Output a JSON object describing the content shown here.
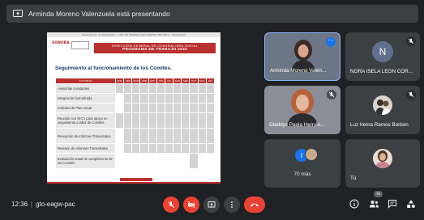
{
  "banner": {
    "text": "Arminda Moreno Valenzuela está presentando"
  },
  "slide": {
    "window_title": "Presentación de PowerPoint - GUÍA DE TRABAJO 2022 DIGITAL SECTOR A - PowerPoint",
    "logo_text": "SONORA",
    "ribbon_line1": "DIRECCIÓN GENERAL DE CONTRALORÍA SOCIAL",
    "ribbon_line2": "PROGRAMA DE TRABAJO 2022",
    "section_title": "Seguimiento al funcionamiento de los Comités.",
    "table": {
      "header": [
        "ACTIVIDAD",
        "ENE",
        "FEB",
        "MAR",
        "ABR",
        "MAY",
        "JUN",
        "JUL",
        "AGO",
        "SEP",
        "OCT",
        "NOV",
        "DIC"
      ],
      "rows": [
        "Asesorías constantes",
        "Integración formalizada",
        "Solicitud de Plan Anual",
        "Reunión con OIC's para apoyo en seguimiento a labor de Comités",
        "Recepción de Informes Trimestrales",
        "Revisión de Informes Trimestrales",
        "Evaluación anual de cumplimiento de los Comités"
      ]
    }
  },
  "participants": [
    {
      "name": "Arminda Moreno Valen...",
      "active_speaker": true
    },
    {
      "name": "NORA ISELA LEON COR...",
      "avatar_letter": "N",
      "muted": true
    },
    {
      "name": "Gladdys Paola Hernán...",
      "muted": true
    },
    {
      "name": "Luz Irema Ramos Borbon",
      "muted": true
    },
    {
      "name": "70 más",
      "avatar_letter": "I"
    },
    {
      "name": "Tú"
    }
  ],
  "bottom": {
    "time": "12:36",
    "meeting_code": "gto-eagw-pac",
    "people_count": "76"
  },
  "colors": {
    "accent_red": "#ea4335",
    "accent_blue": "#1a73e8",
    "slide_red": "#b9302e"
  }
}
